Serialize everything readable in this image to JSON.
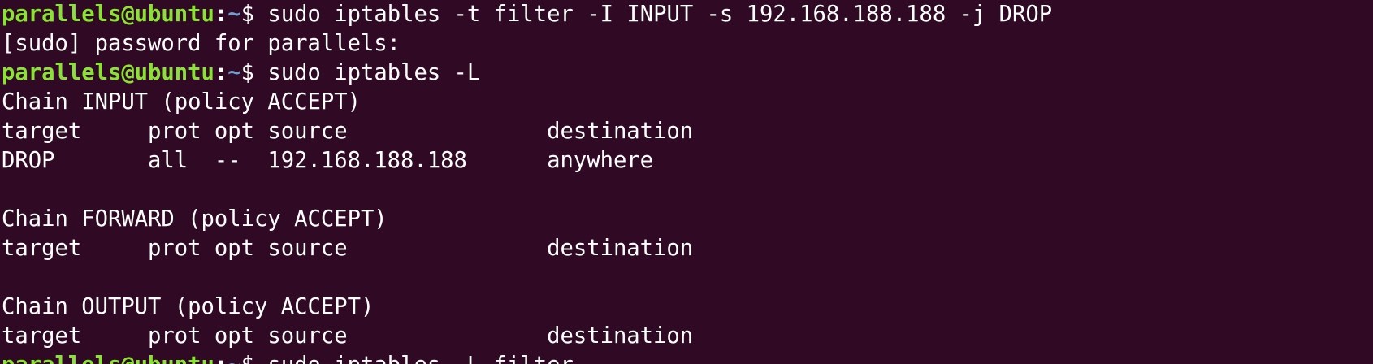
{
  "colors": {
    "background": "#300a24",
    "foreground": "#ffffff",
    "prompt_user": "#8ae234",
    "prompt_path": "#729fcf"
  },
  "prompt": {
    "user_host": "parallels@ubuntu",
    "separator": ":",
    "path": "~",
    "symbol": "$ "
  },
  "lines": [
    {
      "type": "command",
      "command": "sudo iptables -t filter -I INPUT -s 192.168.188.188 -j DROP"
    },
    {
      "type": "output",
      "text": "[sudo] password for parallels:"
    },
    {
      "type": "command",
      "command": "sudo iptables -L"
    },
    {
      "type": "output",
      "text": "Chain INPUT (policy ACCEPT)"
    },
    {
      "type": "output",
      "text": "target     prot opt source               destination"
    },
    {
      "type": "output",
      "text": "DROP       all  --  192.168.188.188      anywhere"
    },
    {
      "type": "output",
      "text": ""
    },
    {
      "type": "output",
      "text": "Chain FORWARD (policy ACCEPT)"
    },
    {
      "type": "output",
      "text": "target     prot opt source               destination"
    },
    {
      "type": "output",
      "text": ""
    },
    {
      "type": "output",
      "text": "Chain OUTPUT (policy ACCEPT)"
    },
    {
      "type": "output",
      "text": "target     prot opt source               destination"
    },
    {
      "type": "command",
      "command": "sudo iptables -L filter"
    }
  ]
}
